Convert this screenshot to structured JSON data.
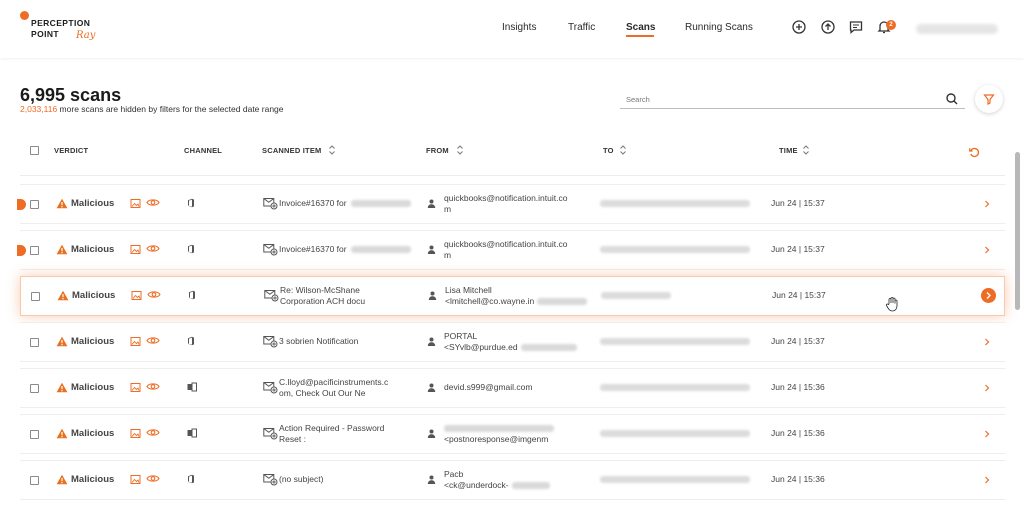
{
  "brand": {
    "line1": "PERCEPTION",
    "line2": "POINT",
    "script": "Ray",
    "color": "#ef6c24"
  },
  "nav": [
    {
      "label": "Insights",
      "active": false
    },
    {
      "label": "Traffic",
      "active": false
    },
    {
      "label": "Scans",
      "active": true
    },
    {
      "label": "Running Scans",
      "active": false
    }
  ],
  "topbar_icons": [
    "plus-circle-icon",
    "upload-icon",
    "message-icon",
    "bell-icon"
  ],
  "notification_count": "2",
  "header": {
    "title": "6,995 scans",
    "hidden_count": "2,033,116",
    "hidden_text": " more scans are hidden by filters for the selected date range"
  },
  "search": {
    "placeholder": "Search"
  },
  "columns": {
    "verdict": "VERDICT",
    "channel": "CHANNEL",
    "scanned_item": "SCANNED ITEM",
    "from": "FROM",
    "to": "TO",
    "time": "TIME"
  },
  "rows": [
    {
      "verdict": "Malicious",
      "channel": "office",
      "item": [
        "Invoice#16370 for"
      ],
      "from": [
        "quickbooks@notification.intuit.co",
        "m"
      ],
      "time": "Jun 24 | 15:37",
      "side_dot": true,
      "highlight": false
    },
    {
      "verdict": "Malicious",
      "channel": "office",
      "item": [
        "Invoice#16370 for"
      ],
      "from": [
        "quickbooks@notification.intuit.co",
        "m"
      ],
      "time": "Jun 24 | 15:37",
      "side_dot": true,
      "highlight": false
    },
    {
      "verdict": "Malicious",
      "channel": "office",
      "item": [
        "Re: Wilson-McShane",
        "Corporation ACH docu"
      ],
      "from": [
        "Lisa Mitchell",
        "<lmitchell@co.wayne.in"
      ],
      "time": "Jun 24 | 15:37",
      "side_dot": false,
      "highlight": true
    },
    {
      "verdict": "Malicious",
      "channel": "office",
      "item": [
        "3 sobrien Notification"
      ],
      "from": [
        "PORTAL",
        "<SYvlb@purdue.ed"
      ],
      "time": "Jun 24 | 15:37",
      "side_dot": false,
      "highlight": false
    },
    {
      "verdict": "Malicious",
      "channel": "exchange",
      "item": [
        "C.lloyd@pacificinstruments.c",
        "om, Check Out Our Ne"
      ],
      "from": [
        "devid.s999@gmail.com"
      ],
      "time": "Jun 24 | 15:36",
      "side_dot": false,
      "highlight": false
    },
    {
      "verdict": "Malicious",
      "channel": "exchange",
      "item": [
        "Action Required - Password",
        "Reset :"
      ],
      "from": [
        "",
        "<postnoresponse@imgenm"
      ],
      "time": "Jun 24 | 15:36",
      "side_dot": false,
      "highlight": false
    },
    {
      "verdict": "Malicious",
      "channel": "office",
      "item": [
        "(no subject)"
      ],
      "from": [
        "Pacb",
        "<ck@underdock-"
      ],
      "time": "Jun 24 | 15:36",
      "side_dot": false,
      "highlight": false
    }
  ],
  "colors": {
    "accent": "#ef6c24",
    "warning": "#e8711f",
    "text": "#2b2b2b"
  }
}
